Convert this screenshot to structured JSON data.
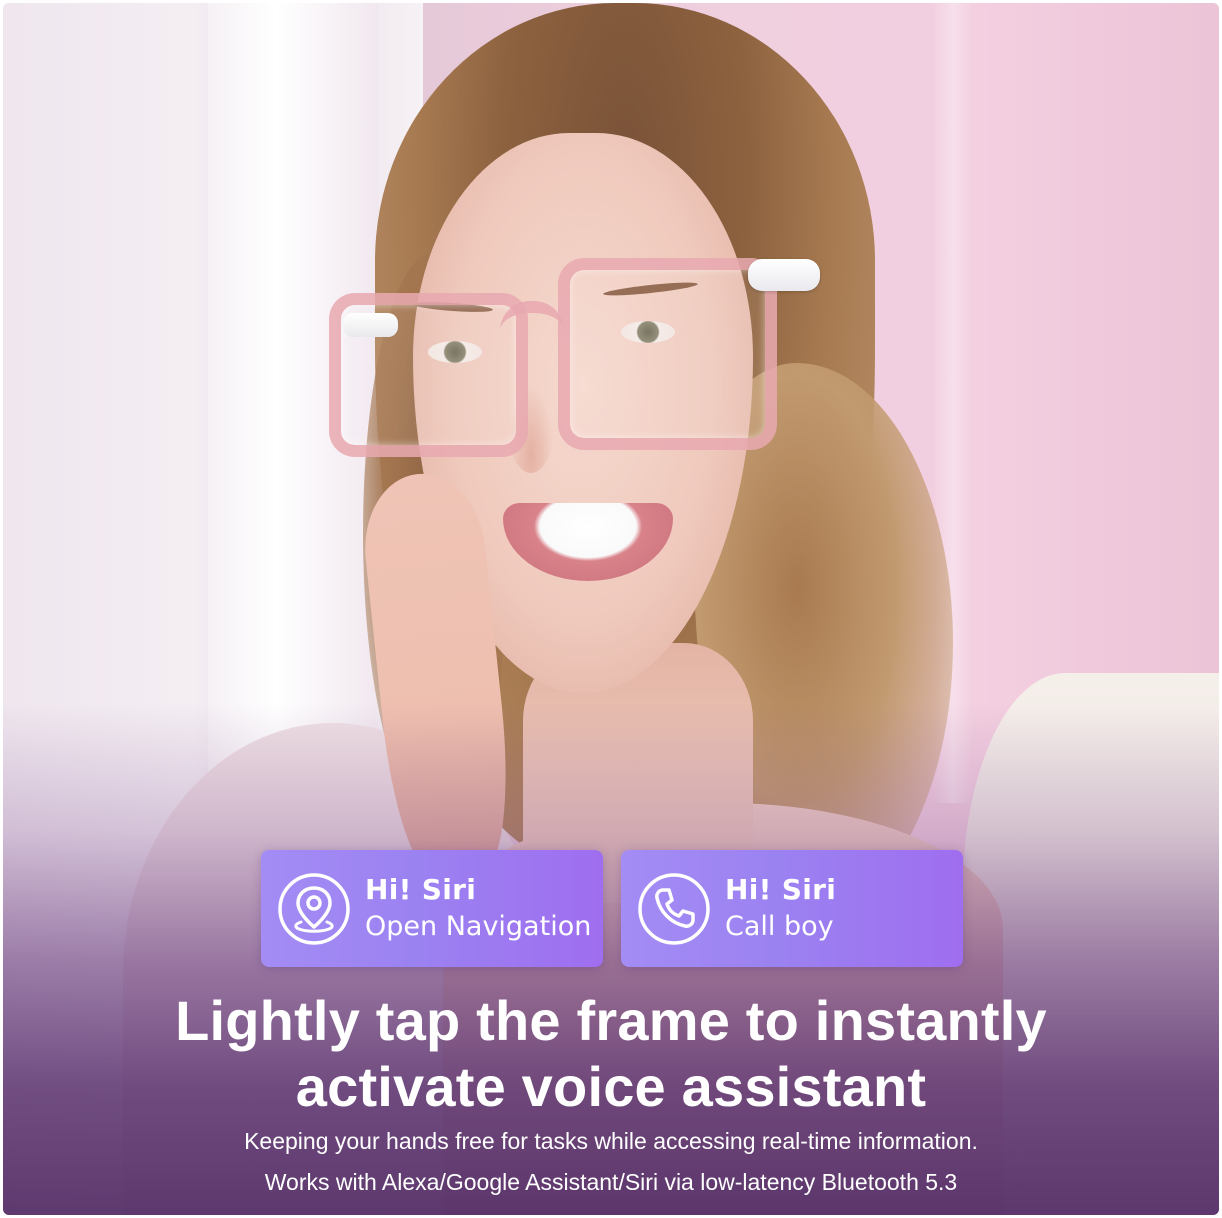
{
  "cards": [
    {
      "greeting": "Hi! Siri",
      "command": "Open Navigation",
      "icon": "location-pin-icon"
    },
    {
      "greeting": "Hi! Siri",
      "command": "Call boy",
      "icon": "phone-icon"
    }
  ],
  "headline": {
    "line1": "Lightly tap the frame to instantly",
    "line2": "activate voice assistant"
  },
  "description": {
    "line1": "Keeping your hands free for tasks while accessing real-time information.",
    "line2": "Works with Alexa/Google Assistant/Siri via low-latency Bluetooth 5.3"
  },
  "colors": {
    "card_gradient_start": "#a48cf5",
    "card_gradient_end": "#9f6ef0",
    "overlay_purple": "#5c3470",
    "frame_pink": "#e8a8af",
    "text": "#ffffff"
  }
}
